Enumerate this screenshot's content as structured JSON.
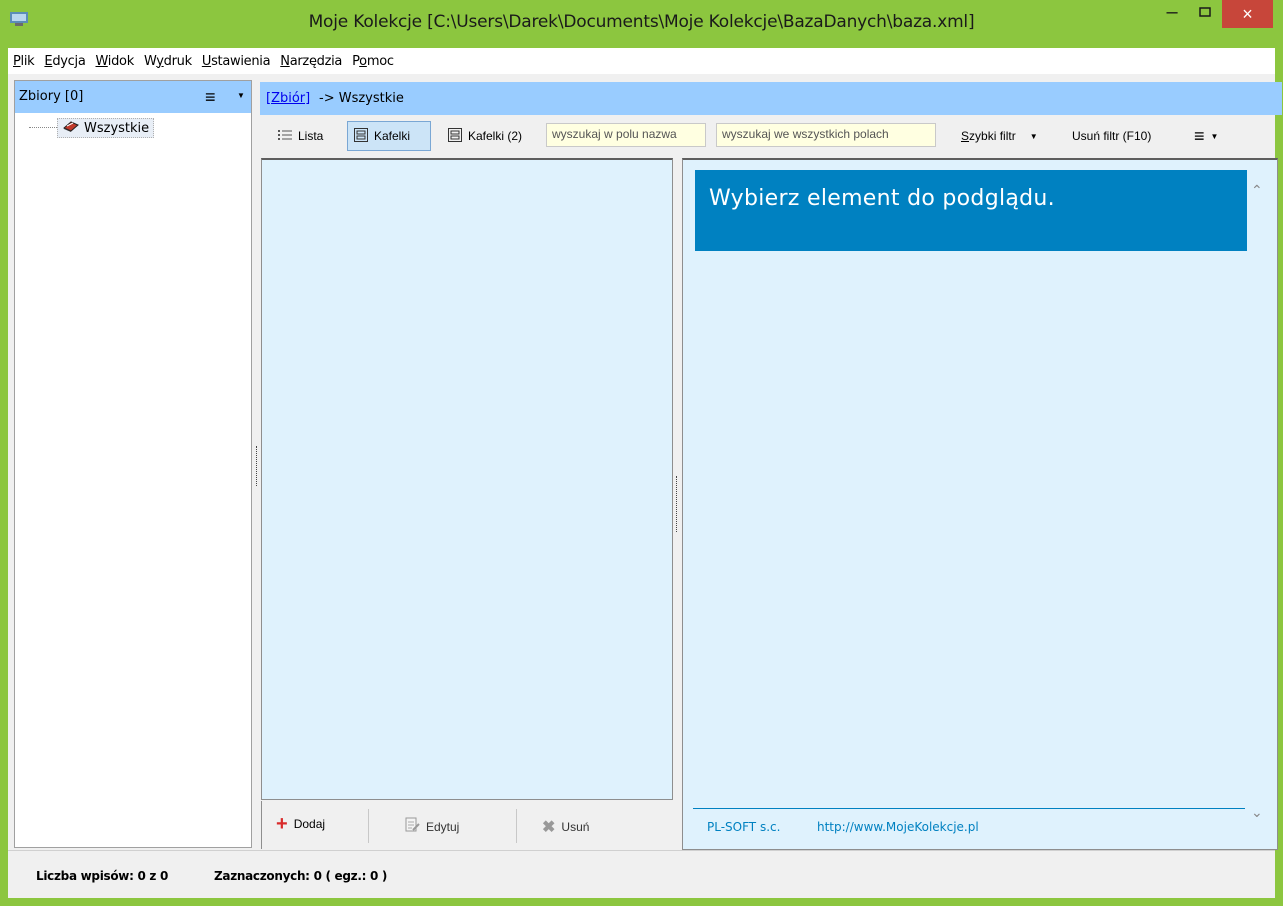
{
  "window": {
    "title": "Moje Kolekcje [C:\\Users\\Darek\\Documents\\Moje Kolekcje\\BazaDanych\\baza.xml]",
    "minimize": "–",
    "close": "×",
    "accent_color": "#8cc63f",
    "close_color": "#c7463a"
  },
  "menu": [
    {
      "key": "P",
      "rest": "lik"
    },
    {
      "key": "E",
      "rest": "dycja"
    },
    {
      "key": "W",
      "rest": "idok"
    },
    {
      "pre": "W",
      "key": "y",
      "rest": "druk"
    },
    {
      "key": "U",
      "rest": "stawienia"
    },
    {
      "key": "N",
      "rest": "arzędzia"
    },
    {
      "pre": "P",
      "key": "o",
      "rest": "moc"
    }
  ],
  "sidebar": {
    "header": "Zbiory [0]",
    "menu_icon": "hamburger-icon",
    "items": [
      {
        "label": "Wszystkie",
        "icon": "collection-icon"
      }
    ]
  },
  "breadcrumb": {
    "link": "[Zbiór]",
    "rest": "-> Wszystkie"
  },
  "toolbar": {
    "lista": "Lista",
    "kafelki": "Kafelki",
    "kafelki2": "Kafelki (2)",
    "search_name_placeholder": "wyszukaj w polu nazwa",
    "search_all_placeholder": "wyszukaj we wszystkich polach",
    "quick_filter": "Szybki filtr",
    "quick_filter_key": "S",
    "quick_filter_rest": "zybki filtr",
    "remove_filter": "Usuń filtr (F10)"
  },
  "list_footer": {
    "add": "Dodaj",
    "edit": "Edytuj",
    "delete": "Usuń"
  },
  "preview": {
    "title": "Wybierz element do podglądu.",
    "company": "PL-SOFT s.c.",
    "url": "http://www.MojeKolekcje.pl",
    "banner_color": "#0081c1"
  },
  "status": {
    "count": "Liczba wpisów: 0 z 0",
    "selected": "Zaznaczonych: 0 ( egz.: 0 )"
  }
}
